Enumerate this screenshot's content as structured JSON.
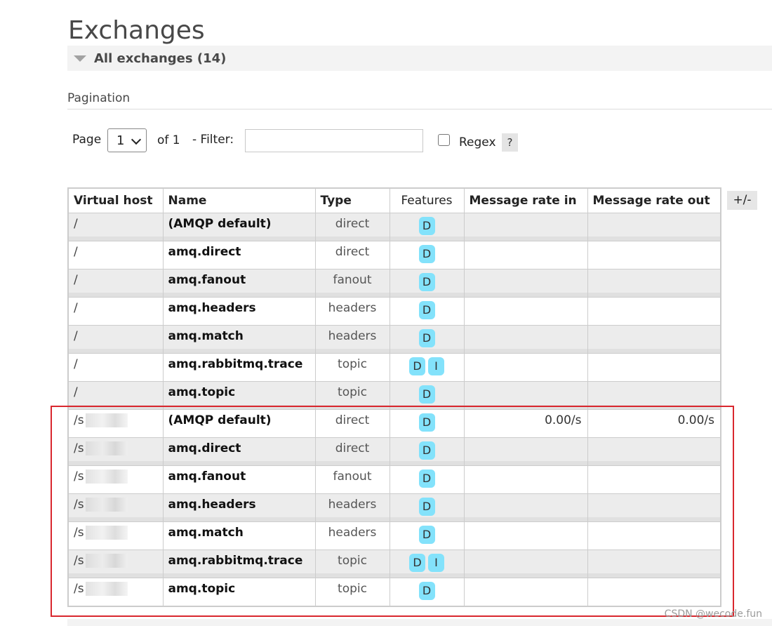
{
  "page": {
    "title": "Exchanges"
  },
  "section": {
    "header": "All exchanges (14)"
  },
  "pagination": {
    "label": "Pagination",
    "page_label": "Page",
    "page_value": "1",
    "of_label": "of 1",
    "filter_label": "- Filter:",
    "filter_value": "",
    "regex_label": "Regex",
    "regex_checked": false,
    "help_label": "?"
  },
  "table": {
    "columns": [
      "Virtual host",
      "Name",
      "Type",
      "Features",
      "Message rate in",
      "Message rate out"
    ],
    "toggle_columns_label": "+/-",
    "rows": [
      {
        "vhost": "/",
        "name": "(AMQP default)",
        "type": "direct",
        "features": [
          "D"
        ],
        "rate_in": "",
        "rate_out": ""
      },
      {
        "vhost": "/",
        "name": "amq.direct",
        "type": "direct",
        "features": [
          "D"
        ],
        "rate_in": "",
        "rate_out": ""
      },
      {
        "vhost": "/",
        "name": "amq.fanout",
        "type": "fanout",
        "features": [
          "D"
        ],
        "rate_in": "",
        "rate_out": ""
      },
      {
        "vhost": "/",
        "name": "amq.headers",
        "type": "headers",
        "features": [
          "D"
        ],
        "rate_in": "",
        "rate_out": ""
      },
      {
        "vhost": "/",
        "name": "amq.match",
        "type": "headers",
        "features": [
          "D"
        ],
        "rate_in": "",
        "rate_out": ""
      },
      {
        "vhost": "/",
        "name": "amq.rabbitmq.trace",
        "type": "topic",
        "features": [
          "D",
          "I"
        ],
        "rate_in": "",
        "rate_out": ""
      },
      {
        "vhost": "/",
        "name": "amq.topic",
        "type": "topic",
        "features": [
          "D"
        ],
        "rate_in": "",
        "rate_out": ""
      },
      {
        "vhost": "/s",
        "name": "(AMQP default)",
        "type": "direct",
        "features": [
          "D"
        ],
        "rate_in": "0.00/s",
        "rate_out": "0.00/s"
      },
      {
        "vhost": "/s",
        "name": "amq.direct",
        "type": "direct",
        "features": [
          "D"
        ],
        "rate_in": "",
        "rate_out": ""
      },
      {
        "vhost": "/s",
        "name": "amq.fanout",
        "type": "fanout",
        "features": [
          "D"
        ],
        "rate_in": "",
        "rate_out": ""
      },
      {
        "vhost": "/s",
        "name": "amq.headers",
        "type": "headers",
        "features": [
          "D"
        ],
        "rate_in": "",
        "rate_out": ""
      },
      {
        "vhost": "/s",
        "name": "amq.match",
        "type": "headers",
        "features": [
          "D"
        ],
        "rate_in": "",
        "rate_out": ""
      },
      {
        "vhost": "/s",
        "name": "amq.rabbitmq.trace",
        "type": "topic",
        "features": [
          "D",
          "I"
        ],
        "rate_in": "",
        "rate_out": ""
      },
      {
        "vhost": "/s",
        "name": "amq.topic",
        "type": "topic",
        "features": [
          "D"
        ],
        "rate_in": "",
        "rate_out": ""
      }
    ]
  },
  "watermark": "CSDN @wecode.fun",
  "colors": {
    "badge": "#83e2fb",
    "highlight": "#d9272e",
    "row_alt": "#ececec"
  }
}
